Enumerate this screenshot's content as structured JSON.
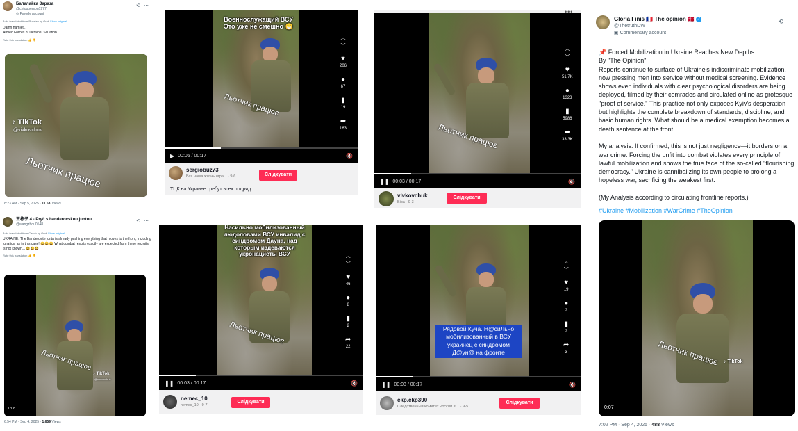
{
  "post1": {
    "name": "Балалайка Зараза",
    "handle": "@chtopperson1977",
    "badge": "Parody account",
    "translation_note": "Auto-translated from Russian by Grok",
    "show_original": "Show original",
    "text": "Damn hamlet...\nArmed Forces of Ukraine. Situation.",
    "rate": "Rate this translation",
    "tiktok_handle": "@vivkovchuk",
    "watermark": "Льотчик працює",
    "time": "8:23 AM · Sep 5, 2025 ·",
    "views_count": "11.6K",
    "views_label": "Views"
  },
  "post2": {
    "name": "王栋子 4 - Pryč s banderovskou juntou",
    "handle": "@wangzhou0148",
    "translation_note": "Auto-translated from Czech by Grok",
    "show_original": "Show original",
    "text": "UKRAINE: The Banderovite junta is already pushing everything that moves to the front, including lunatics, as in this case! 😆😆😆 What combat results exactly are expected from these recruits is not known... 😆😆😆",
    "rate": "Rate this translation",
    "watermark": "Льотчик працює",
    "tiktok_logo": "TikTok",
    "tiktok_handle": "@vivkovchuk",
    "duration": "0:08",
    "time": "6:54 PM · Sep 4, 2025 ·",
    "views_count": "1,659",
    "views_label": "Views"
  },
  "tt1": {
    "caption": "Военнослужащий ВСУ\nЭто уже не смешно 😁",
    "watermark": "Льотчик працює",
    "likes": "206",
    "comments": "67",
    "saves": "19",
    "shares": "163",
    "time": "00:05 / 00:17",
    "progress": 0.29,
    "user": "sergiobuz73",
    "sub": "Вся наша жизнь игра... · 9-6",
    "follow": "Слідкувати",
    "desc": "ТЦК на Украине гребут всех подряд"
  },
  "tt2": {
    "watermark": "Льотчик працює",
    "likes": "51.7K",
    "comments": "1323",
    "saves": "5986",
    "shares": "33.3K",
    "time": "00:03 / 00:17",
    "progress": 0.18,
    "user": "vivkovchuk",
    "sub": "Віва · 9-3",
    "follow": "Слідкувати"
  },
  "tt3": {
    "caption": "Насильно мобилизованный людоловами ВСУ инвалид с синдромом Дауна, над которым издеваются укронацисты ВСУ",
    "watermark": "Льотчик працює",
    "likes": "46",
    "comments": "8",
    "saves": "2",
    "shares": "22",
    "time": "00:03 / 00:17",
    "progress": 0.18,
    "user": "nemec_10",
    "sub": "nemec_10 · 9-7",
    "follow": "Слідкувати"
  },
  "tt4": {
    "caption": "Рядовой Куча. Н@сиЛьно мобилизованный в ВСУ украинец с синдромом Д@ун@ на фронте",
    "likes": "19",
    "comments": "2",
    "saves": "2",
    "shares": "3",
    "time": "00:03 / 00:17",
    "progress": 0.18,
    "user": "ckp.ckp390",
    "sub": "Следственный комитет России Ф... · 9-5",
    "follow": "Слідкувати"
  },
  "gloria": {
    "name": "Gloria Finis 🇫🇷 The opinion 🇩🇰",
    "handle": "@ThetruthDW",
    "badge": "Commentary account",
    "body": "📌 Forced Mobilization in Ukraine Reaches New Depths\nBy \"The Opinion\"\nReports continue to surface of Ukraine's indiscriminate mobilization, now pressing men into service without medical screening. Evidence shows even individuals with clear psychological disorders are being deployed, filmed by their comrades and circulated online as grotesque \"proof of service.\" This practice not only exposes Kyiv's desperation but highlights the complete breakdown of standards, discipline, and basic human rights. What should be a medical exemption becomes a death sentence at the front.\n\nMy analysis: If confirmed, this is not just negligence—it borders on a war crime. Forcing the unfit into combat violates every principle of lawful mobilization and shows the true face of the so-called \"flourishing democracy.\" Ukraine is cannibalizing its own people to prolong a hopeless war, sacrificing the weakest first.\n\n(My Analysis according to circulating frontline reports.)",
    "tags": "#Ukraine #Mobilization #WarCrime #TheOpinion",
    "watermark": "Льотчик працює",
    "tiktok_logo": "TikTok",
    "duration": "0:07",
    "time": "7:02 PM · Sep 4, 2025 ·",
    "views_count": "488",
    "views_label": "Views"
  },
  "icons": {
    "grok": "grok-icon",
    "more": "more-icon",
    "like": "heart-icon",
    "comment": "comment-icon",
    "save": "bookmark-icon",
    "share": "share-icon",
    "play": "play-icon",
    "pause": "pause-icon",
    "volume": "volume-icon",
    "up": "chevron-up-icon",
    "down": "chevron-down-icon"
  },
  "colors": {
    "follow": "#fe2c55",
    "link": "#1d9bf0",
    "helmet": "#2f4fa7",
    "caption_box": "#1d45c4"
  }
}
